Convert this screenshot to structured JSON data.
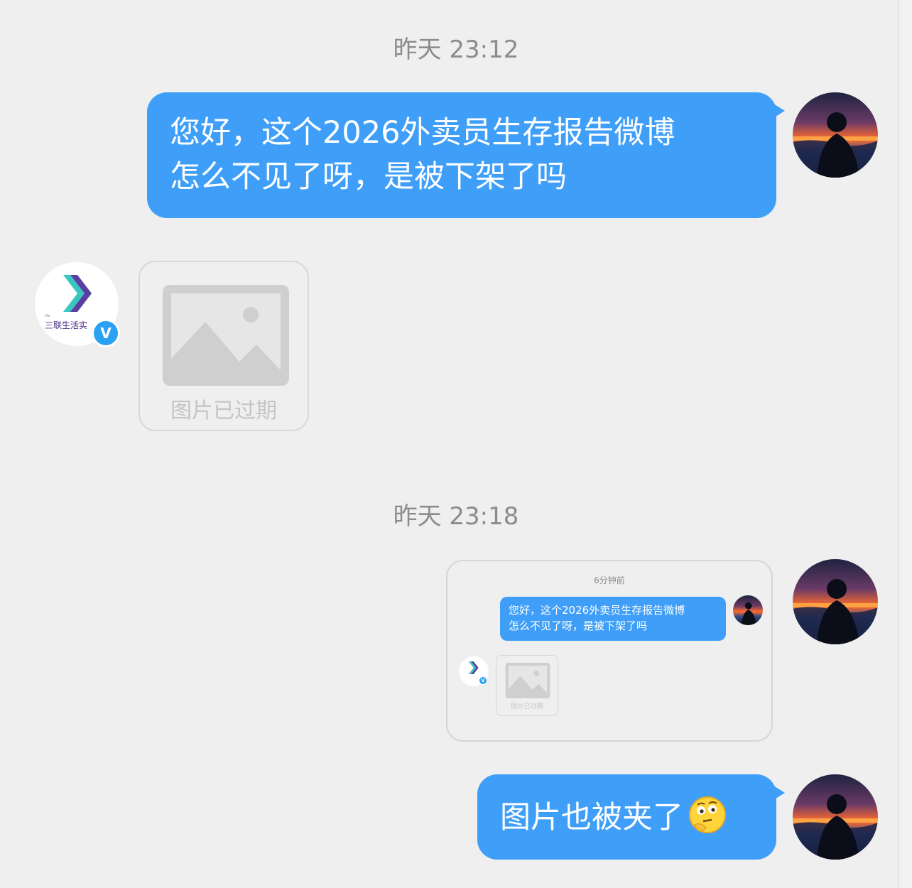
{
  "colors": {
    "background": "#efefef",
    "bubble_outgoing": "#3f9ff8",
    "timestamp_text": "#8c8c8c",
    "verified_badge": "#2aa1f2"
  },
  "timestamps": [
    "昨天 23:12",
    "昨天 23:18"
  ],
  "messages": {
    "first": {
      "lines": [
        "您好，这个2026外卖员生存报告微博",
        "怎么不见了呀，是被下架了吗"
      ]
    },
    "reply_image": {
      "label": "图片已过期",
      "icon": "image-placeholder-icon"
    },
    "shared_screenshot": {
      "time": "6分钟前",
      "lines": [
        "您好，这个2026外卖员生存报告微博",
        "怎么不见了呀，是被下架了吗"
      ],
      "expired_label": "图片已过期"
    },
    "last": {
      "text": "图片也被夹了",
      "emoji": "thinking-face-emoji"
    }
  },
  "account": {
    "name_logo": "三联生活实",
    "tiny": "life",
    "verified": "V"
  }
}
